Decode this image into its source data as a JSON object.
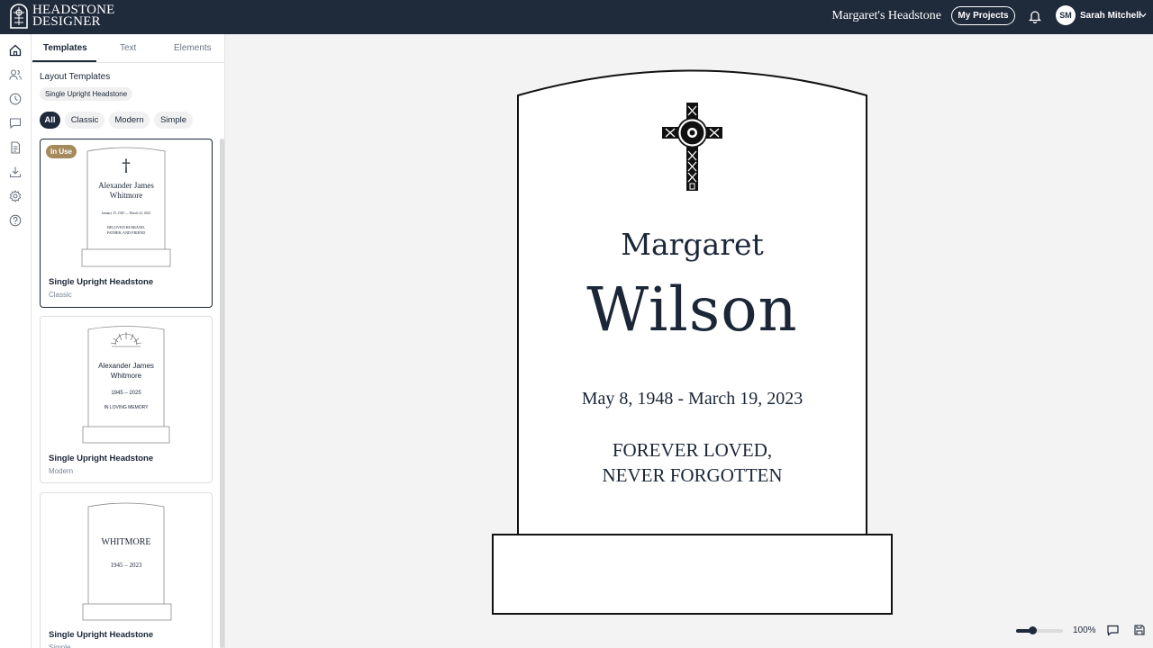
{
  "app": {
    "logo_text_line1": "HEADSTONE",
    "logo_text_line2": "DESIGNER",
    "project_title": "Margaret's Headstone",
    "my_projects_label": "My Projects",
    "user_initials": "SM",
    "user_name": "Sarah Mitchell"
  },
  "rail": {
    "icons": [
      "home-icon",
      "users-icon",
      "clock-icon",
      "message-icon",
      "document-icon",
      "download-icon",
      "settings-icon",
      "help-icon"
    ]
  },
  "panel": {
    "tabs": [
      {
        "label": "Templates",
        "active": true
      },
      {
        "label": "Text",
        "active": false
      },
      {
        "label": "Elements",
        "active": false
      }
    ],
    "section_title": "Layout Templates",
    "current_template": "Single Upright Headstone",
    "filters": [
      {
        "label": "All",
        "active": true
      },
      {
        "label": "Classic",
        "active": false
      },
      {
        "label": "Modern",
        "active": false
      },
      {
        "label": "Simple",
        "active": false
      }
    ],
    "cards": [
      {
        "badge": "In Use",
        "name": "Single Upright Headstone",
        "style": "Classic",
        "preview": {
          "symbol": "†",
          "name_line1": "Alexander James",
          "name_line2": "Whitmore",
          "dates": "January 15, 1945 — March 22, 2023",
          "epitaph_line1": "BELOVED HUSBAND,",
          "epitaph_line2": "FATHER, AND FRIEND"
        }
      },
      {
        "name": "Single Upright Headstone",
        "style": "Modern",
        "preview": {
          "symbol": "sunrise-icon",
          "name_line1": "Alexander James",
          "name_line2": "Whitmore",
          "dates": "1945 – 2025",
          "epitaph_line1": "IN LOVING MEMORY"
        }
      },
      {
        "name": "Single Upright Headstone",
        "style": "Simple",
        "preview": {
          "surname": "WHITMORE",
          "dates": "1945 – 2023"
        }
      }
    ]
  },
  "headstone": {
    "symbol": "celtic-cross-icon",
    "first_name": "Margaret",
    "last_name": "Wilson",
    "dates": "May 8, 1948 - March 19, 2023",
    "epitaph_line1": "FOREVER LOVED,",
    "epitaph_line2": "NEVER FORGOTTEN"
  },
  "footer": {
    "zoom_label": "100%",
    "zoom_level": 0.35
  },
  "colors": {
    "topbar": "#1f2a3b",
    "accent_badge": "#a58a5c",
    "ink": "#1b2637"
  }
}
